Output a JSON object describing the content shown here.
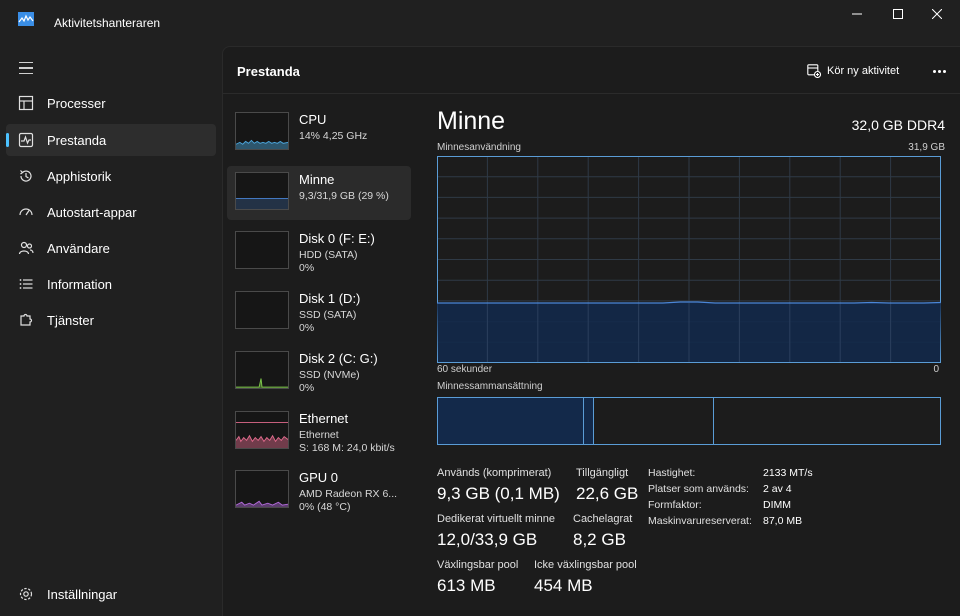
{
  "window": {
    "title": "Aktivitetshanteraren",
    "controls": [
      "minimize-icon",
      "maximize-icon",
      "close-icon"
    ]
  },
  "sidebar": {
    "items": [
      {
        "label": "Processer",
        "icon": "processes-grid-icon",
        "active": false
      },
      {
        "label": "Prestanda",
        "icon": "performance-chart-icon",
        "active": true
      },
      {
        "label": "Apphistorik",
        "icon": "history-icon",
        "active": false
      },
      {
        "label": "Autostart-appar",
        "icon": "startup-speedometer-icon",
        "active": false
      },
      {
        "label": "Användare",
        "icon": "users-icon",
        "active": false
      },
      {
        "label": "Information",
        "icon": "details-list-icon",
        "active": false
      },
      {
        "label": "Tjänster",
        "icon": "services-puzzle-icon",
        "active": false
      }
    ],
    "settings_label": "Inställningar"
  },
  "header": {
    "title": "Prestanda",
    "run_task_label": "Kör ny aktivitet"
  },
  "devices": [
    {
      "name": "CPU",
      "sub": "14% 4,25 GHz",
      "sub2": "",
      "color": "#4aa3d8",
      "selected": false
    },
    {
      "name": "Minne",
      "sub": "9,3/31,9 GB (29 %)",
      "sub2": "",
      "color": "#4a86d8",
      "selected": true
    },
    {
      "name": "Disk 0 (F: E:)",
      "sub": "HDD (SATA)",
      "sub2": "0%",
      "color": "#7cc44a",
      "selected": false
    },
    {
      "name": "Disk 1 (D:)",
      "sub": "SSD (SATA)",
      "sub2": "0%",
      "color": "#7cc44a",
      "selected": false
    },
    {
      "name": "Disk 2 (C: G:)",
      "sub": "SSD (NVMe)",
      "sub2": "0%",
      "color": "#7cc44a",
      "selected": false
    },
    {
      "name": "Ethernet",
      "sub": "Ethernet",
      "sub2": "S: 168 M: 24,0 kbit/s",
      "color": "#e06a8c",
      "selected": false
    },
    {
      "name": "GPU 0",
      "sub": "AMD Radeon RX 6...",
      "sub2": "0% (48 °C)",
      "color": "#b06ad8",
      "selected": false
    }
  ],
  "memory": {
    "title": "Minne",
    "spec": "32,0 GB DDR4",
    "usage_label": "Minnesanvändning",
    "usage_max": "31,9 GB",
    "time_left": "60 sekunder",
    "time_right": "0",
    "usage_fraction": 0.29,
    "composition_label": "Minnessammansättning",
    "composition_fractions": {
      "in_use": 0.29,
      "modified": 0.02,
      "standby": 0.24,
      "free": 0.45
    },
    "stats": {
      "in_use_label": "Används (komprimerat)",
      "in_use_value": "9,3 GB (0,1 MB)",
      "available_label": "Tillgängligt",
      "available_value": "22,6 GB",
      "committed_label": "Dedikerat virtuellt minne",
      "committed_value": "12,0/33,9 GB",
      "cached_label": "Cachelagrat",
      "cached_value": "8,2 GB",
      "paged_label": "Växlingsbar pool",
      "paged_value": "613 MB",
      "nonpaged_label": "Icke växlingsbar pool",
      "nonpaged_value": "454 MB"
    },
    "details": [
      {
        "key": "Hastighet:",
        "value": "2133 MT/s"
      },
      {
        "key": "Platser som används:",
        "value": "2 av 4"
      },
      {
        "key": "Formfaktor:",
        "value": "DIMM"
      },
      {
        "key": "Maskinvarureserverat:",
        "value": "87,0 MB"
      }
    ]
  },
  "colors": {
    "accent": "#4cc2ff",
    "memory_line": "#4a86d8",
    "memory_fill": "#13294a"
  }
}
